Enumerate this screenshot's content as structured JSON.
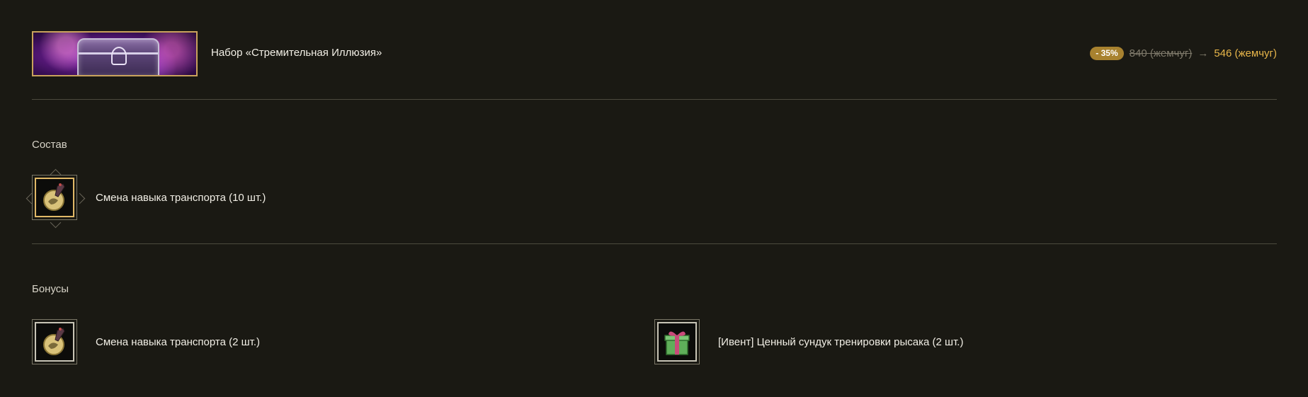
{
  "bundle": {
    "name": "Набор «Стремительная Иллюзия»",
    "discount_badge": "- 35%",
    "old_price": "840 (жемчуг)",
    "arrow": "→",
    "new_price": "546 (жемчуг)",
    "banner_icon": "purple-treasure-chest-image"
  },
  "contents": {
    "title": "Состав",
    "items": [
      {
        "label": "Смена навыка транспорта (10 шт.)",
        "icon": "mount-skill-change-scroll-icon"
      }
    ]
  },
  "bonuses": {
    "title": "Бонусы",
    "items": [
      {
        "label": "Смена навыка транспорта (2 шт.)",
        "icon": "mount-skill-change-scroll-icon"
      },
      {
        "label": "[Ивент] Ценный сундук тренировки рысака (2 шт.)",
        "icon": "gift-box-icon"
      }
    ]
  },
  "colors": {
    "background": "#1a1913",
    "accent_gold": "#e8b64a",
    "badge": "#a8822f",
    "divider": "#4c4a3e"
  }
}
